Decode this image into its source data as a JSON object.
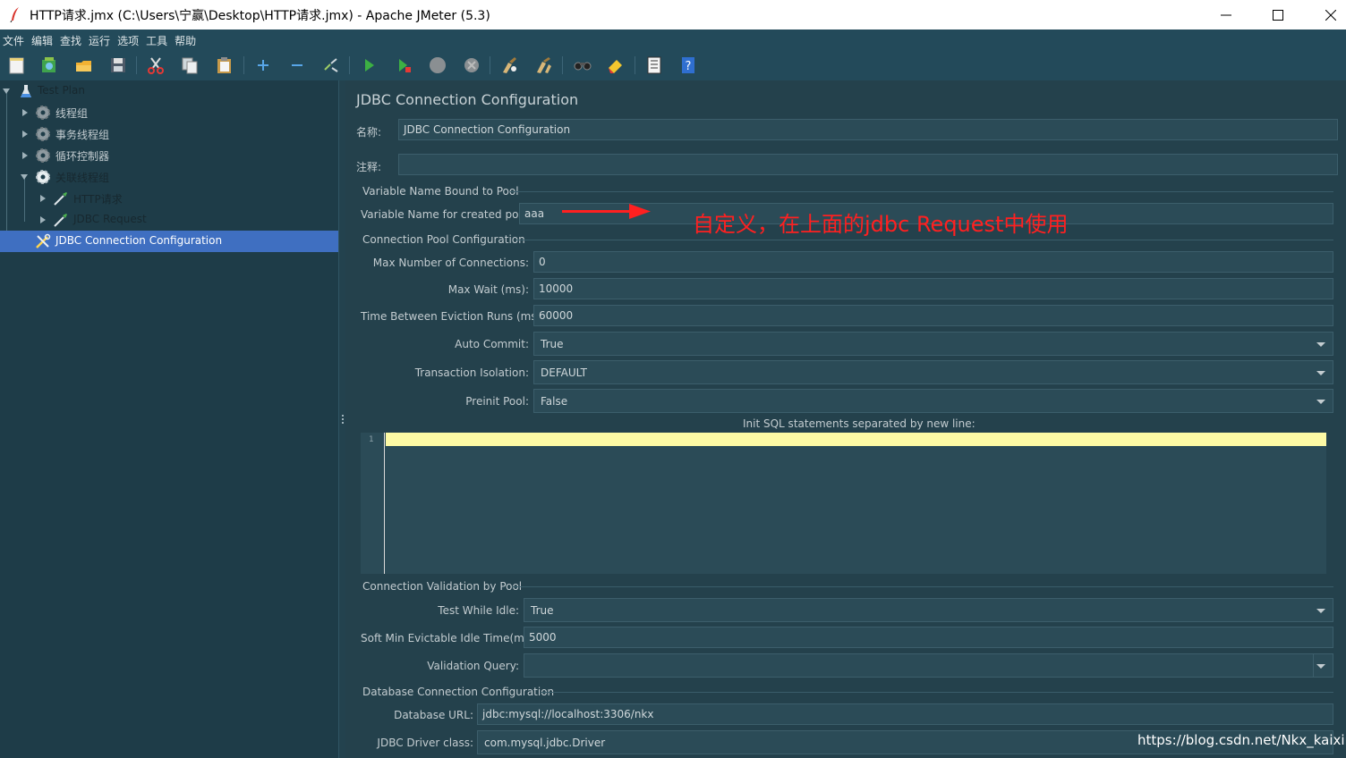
{
  "window": {
    "title": "HTTP请求.jmx (C:\\Users\\宁赢\\Desktop\\HTTP请求.jmx) - Apache JMeter (5.3)"
  },
  "menubar": {
    "items": [
      "文件",
      "编辑",
      "查找",
      "运行",
      "选项",
      "工具",
      "帮助"
    ]
  },
  "toolbar": {
    "icons": [
      "new-icon",
      "templates-icon",
      "open-icon",
      "save-icon",
      "cut-icon",
      "copy-icon",
      "paste-icon",
      "expand-icon",
      "collapse-icon",
      "toggle-icon",
      "start-icon",
      "start-no-pause-icon",
      "stop-icon",
      "shutdown-icon",
      "clear-icon",
      "clear-all-icon",
      "search-icon",
      "reset-search-icon",
      "function-helper-icon",
      "help-icon"
    ]
  },
  "tree": {
    "items": [
      {
        "label": "Test Plan"
      },
      {
        "label": "线程组"
      },
      {
        "label": "事务线程组"
      },
      {
        "label": "循环控制器"
      },
      {
        "label": "关联线程组"
      },
      {
        "label": "HTTP请求"
      },
      {
        "label": "JDBC Request"
      },
      {
        "label": "JDBC Connection Configuration"
      }
    ]
  },
  "panel": {
    "title": "JDBC Connection Configuration",
    "name_label": "名称:",
    "name_value": "JDBC Connection Configuration",
    "comment_label": "注释:",
    "comment_value": "",
    "section_bound": "Variable Name Bound to Pool",
    "varname_label": "Variable Name for created pool:",
    "varname_value": "aaa",
    "section_pool": "Connection Pool Configuration",
    "max_conn_label": "Max Number of Connections:",
    "max_conn_value": "0",
    "max_wait_label": "Max Wait (ms):",
    "max_wait_value": "10000",
    "eviction_label": "Time Between Eviction Runs (ms):",
    "eviction_value": "60000",
    "auto_commit_label": "Auto Commit:",
    "auto_commit_value": "True",
    "isolation_label": "Transaction Isolation:",
    "isolation_value": "DEFAULT",
    "preinit_label": "Preinit Pool:",
    "preinit_value": "False",
    "init_sql_label": "Init SQL statements separated by new line:",
    "line_number": "1",
    "section_validation": "Connection Validation by Pool",
    "test_idle_label": "Test While Idle:",
    "test_idle_value": "True",
    "soft_min_label": "Soft Min Evictable Idle Time(ms):",
    "soft_min_value": "5000",
    "validation_query_label": "Validation Query:",
    "validation_query_value": "",
    "section_db": "Database Connection Configuration",
    "db_url_label": "Database URL:",
    "db_url_value": "jdbc:mysql://localhost:3306/nkx",
    "driver_label": "JDBC Driver class:",
    "driver_value": "com.mysql.jdbc.Driver"
  },
  "annotation": {
    "text": "自定义，在上面的jdbc Request中使用",
    "color": "#ff2020"
  },
  "watermark": "https://blog.csdn.net/Nkx_kaixin"
}
